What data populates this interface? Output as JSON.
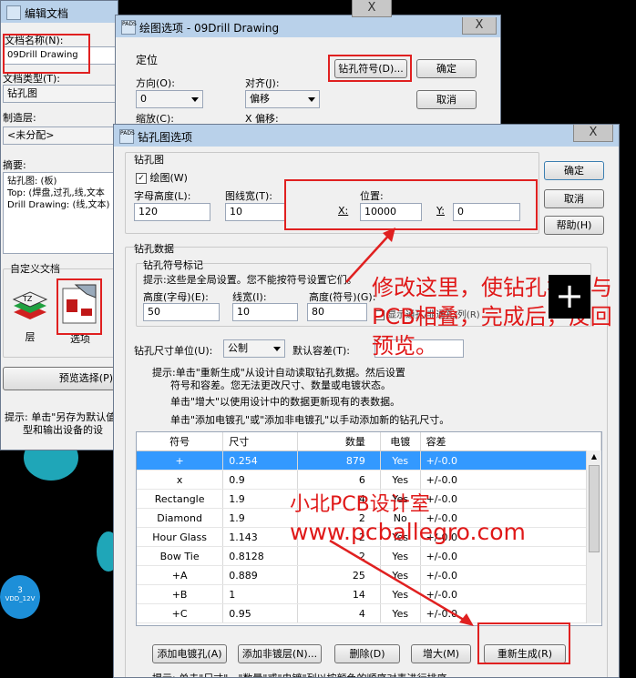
{
  "colors": {
    "accent": "#e02020",
    "selection": "#3399ff",
    "title_bar": "#b9d1ea"
  },
  "edit_doc": {
    "title": "编辑文档",
    "close": "X",
    "doc_name_label": "文档名称(N):",
    "doc_name_value": "09Drill Drawing",
    "doc_type_label": "文档类型(T):",
    "doc_type_value": "钻孔图",
    "layer_label": "制造层:",
    "layer_value": "<未分配>",
    "summary_label": "摘要:",
    "summary_lines": [
      "钻孔图: (板)",
      "Top: (焊盘,过孔,线,文本",
      "Drill Drawing: (线,文本)"
    ],
    "custom_doc_label": "自定义文档",
    "layer_icon_label": "层",
    "options_icon_label": "选项",
    "preview_button": "预览选择(P)",
    "hint_lines": [
      "提示: 单击\"另存为默认值",
      "型和输出设备的设"
    ]
  },
  "draw_options": {
    "icon_text": "PADS",
    "title": "绘图选项 - 09Drill Drawing",
    "close": "X",
    "position_group": "定位",
    "direction_label": "方向(O):",
    "direction_value": "0",
    "align_label": "对齐(J):",
    "align_value": "偏移",
    "zoom_label": "缩放(C):",
    "x_offset_label": "X 偏移:",
    "drill_symbol_button": "钻孔符号(D)...",
    "ok_button": "确定",
    "cancel_button": "取消"
  },
  "drill_options": {
    "icon_text": "PADS",
    "title": "钻孔图选项",
    "close": "X",
    "drill_map_group": "钻孔图",
    "drawing_checkbox": "绘图(W)",
    "char_height_label": "字母高度(L):",
    "char_height_value": "120",
    "line_width_label": "图线宽(T):",
    "line_width_value": "10",
    "position_label": "位置:",
    "x_label": "X:",
    "x_value": "10000",
    "y_label": "Y:",
    "y_value": "0",
    "ok_button": "确定",
    "cancel_button": "取消",
    "help_button": "帮助(H)",
    "drill_data_group": "钻孔数据",
    "symbol_marker_group": "钻孔符号标记",
    "symbol_hint": "提示:这些是全局设置。您不能按符号设置它们。",
    "h_char_label": "高度(字母)(E):",
    "h_char_value": "50",
    "lw_label": "线宽(I):",
    "lw_value": "10",
    "h_symbol_label": "高度(符号)(G):",
    "h_symbol_value": "80",
    "show_plated_label": "显示通孔/非通孔/列(R)",
    "size_unit_label": "钻孔尺寸单位(U):",
    "size_unit_value": "公制",
    "tolerance_label": "默认容差(T):",
    "hint_lines": [
      "提示:单击\"重新生成\"从设计自动读取钻孔数据。然后设置",
      "符号和容差。您无法更改尺寸、数量或电镀状态。",
      "单击\"增大\"以使用设计中的数据更新现有的表数据。",
      "单击\"添加电镀孔\"或\"添加非电镀孔\"以手动添加新的钻孔尺寸。"
    ],
    "table": {
      "headers": [
        "符号",
        "尺寸",
        "数量",
        "电镀",
        "容差"
      ],
      "rows": [
        [
          "+",
          "0.254",
          "879",
          "Yes",
          "+/-0.0"
        ],
        [
          "x",
          "0.9",
          "6",
          "Yes",
          "+/-0.0"
        ],
        [
          "Rectangle",
          "1.9",
          "4",
          "Yes",
          "+/-0.0"
        ],
        [
          "Diamond",
          "1.9",
          "2",
          "No",
          "+/-0.0"
        ],
        [
          "Hour Glass",
          "1.143",
          "2",
          "Yes",
          "+/-0.0"
        ],
        [
          "Bow Tie",
          "0.8128",
          "2",
          "Yes",
          "+/-0.0"
        ],
        [
          "+A",
          "0.889",
          "25",
          "Yes",
          "+/-0.0"
        ],
        [
          "+B",
          "1",
          "14",
          "Yes",
          "+/-0.0"
        ],
        [
          "+C",
          "0.95",
          "4",
          "Yes",
          "+/-0.0"
        ]
      ]
    },
    "add_plated_button": "添加电镀孔(A)",
    "add_nonplated_button": "添加非镀层(N)...",
    "delete_button": "删除(D)",
    "increase_button": "增大(M)",
    "regenerate_button": "重新生成(R)",
    "bottom_hint": "提示: 单击\"尺寸\"、\"数量\"或\"电镀\"列以按颜色的顺序对表进行排序"
  },
  "annotations": {
    "main_note": "修改这里，使钻孔符不与PCB相叠，完成后，反回预览。",
    "studio_name": "小北PCB设计室",
    "website": "www.pcballegro.com",
    "plus_icon": "+"
  },
  "pcb": {
    "pad_number": "3",
    "pad_net": "VDD_12V"
  }
}
